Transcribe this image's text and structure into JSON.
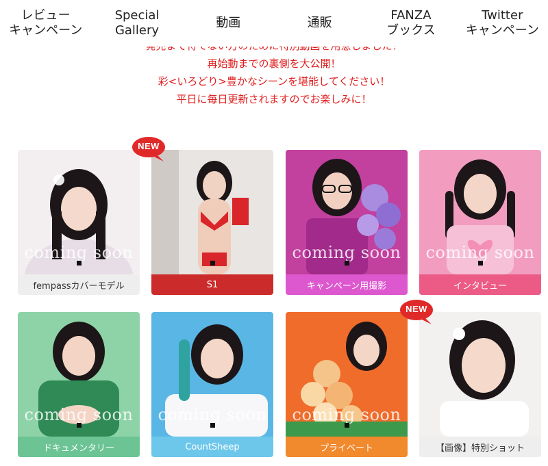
{
  "nav": {
    "items": [
      {
        "line1": "レビュー",
        "line2": "キャンペーン"
      },
      {
        "line1": "Special",
        "line2": "Gallery"
      },
      {
        "line1": "動画",
        "line2": ""
      },
      {
        "line1": "通販",
        "line2": ""
      },
      {
        "line1": "FANZA",
        "line2": "ブックス"
      },
      {
        "line1": "Twitter",
        "line2": "キャンペーン"
      }
    ]
  },
  "intro": {
    "lines": [
      "発売まで待てない方のために特別動画を用意しました！",
      "再始動までの裏側を大公開！",
      "彩<いろどり>豊かなシーンを堪能してください！",
      "平日に毎日更新されますのでお楽しみに！"
    ]
  },
  "badge": {
    "text": "NEW",
    "color": "#e02a2a"
  },
  "overlay_text": "coming soon",
  "cards": [
    {
      "label": "fempassカバーモデル",
      "color": "#eeeeee",
      "new": false,
      "coming_soon": true,
      "bg": "#f1eef0"
    },
    {
      "label": "S1",
      "color": "#cc2b2b",
      "new": true,
      "coming_soon": false,
      "bg": "#e6e3df"
    },
    {
      "label": "キャンペーン用撮影",
      "color": "#dd58cf",
      "new": false,
      "coming_soon": true,
      "bg": "#c83fa3"
    },
    {
      "label": "インタビュー",
      "color": "#ec5b86",
      "new": false,
      "coming_soon": true,
      "bg": "#f2a6c4"
    },
    {
      "label": "ドキュメンタリー",
      "color": "#6cc495",
      "new": false,
      "coming_soon": true,
      "bg": "#8fd3a8"
    },
    {
      "label": "CountSheep",
      "color": "#6dc7ea",
      "new": false,
      "coming_soon": true,
      "bg": "#5bb7e6"
    },
    {
      "label": "プライベート",
      "color": "#f1892d",
      "new": false,
      "coming_soon": true,
      "bg": "#f06a2a"
    },
    {
      "label": "【画像】特別ショット",
      "color": "#eeeeee",
      "new": true,
      "coming_soon": false,
      "bg": "#f4f2f1"
    }
  ]
}
